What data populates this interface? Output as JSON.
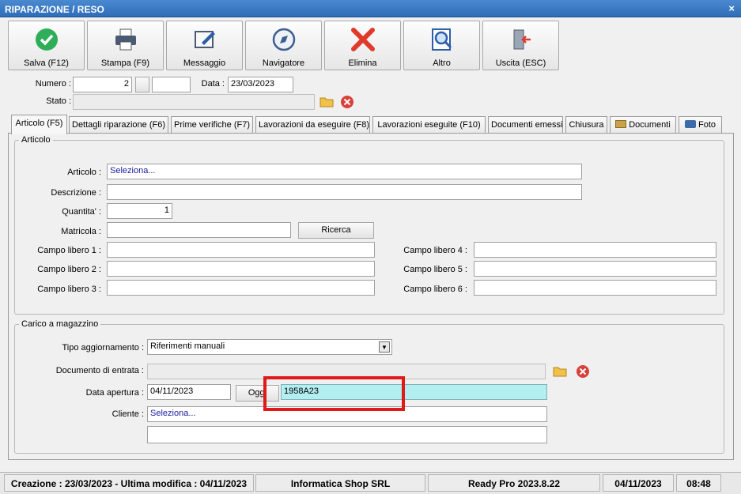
{
  "window": {
    "title": "RIPARAZIONE / RESO",
    "close": "×"
  },
  "toolbar": [
    {
      "label": "Salva (F12)",
      "icon": "check-circle-icon"
    },
    {
      "label": "Stampa (F9)",
      "icon": "printer-icon"
    },
    {
      "label": "Messaggio",
      "icon": "message-edit-icon"
    },
    {
      "label": "Navigatore",
      "icon": "compass-icon"
    },
    {
      "label": "Elimina",
      "icon": "delete-x-icon"
    },
    {
      "label": "Altro",
      "icon": "search-document-icon"
    },
    {
      "label": "Uscita (ESC)",
      "icon": "exit-door-icon"
    }
  ],
  "header": {
    "numero_label": "Numero :",
    "numero_value": "2",
    "data_label": "Data :",
    "data_value": "23/03/2023",
    "stato_label": "Stato :"
  },
  "tabs": [
    "Articolo (F5)",
    "Dettagli riparazione (F6)",
    "Prime verifiche (F7)",
    "Lavorazioni da eseguire (F8)",
    "Lavorazioni eseguite  (F10)",
    "Documenti emessi",
    "Chiusura",
    "Documenti",
    "Foto"
  ],
  "articolo": {
    "group_title": "Articolo",
    "articolo_label": "Articolo :",
    "articolo_value": "Seleziona...",
    "descrizione_label": "Descrizione :",
    "quantita_label": "Quantita' :",
    "quantita_value": "1",
    "matricola_label": "Matricola :",
    "ricerca_label": "Ricerca",
    "campo1_label": "Campo libero 1 :",
    "campo2_label": "Campo libero 2 :",
    "campo3_label": "Campo libero 3 :",
    "campo4_label": "Campo libero 4 :",
    "campo5_label": "Campo libero 5 :",
    "campo6_label": "Campo libero 6 :"
  },
  "carico": {
    "group_title": "Carico a magazzino",
    "tipo_label": "Tipo aggiornamento :",
    "tipo_value": "Riferimenti manuali",
    "documento_label": "Documento di entrata :",
    "data_apertura_label": "Data apertura :",
    "data_apertura_value": "04/11/2023",
    "oggi_label": "Oggi",
    "code_value": "1958A23",
    "cliente_label": "Cliente :",
    "cliente_value": "Seleziona..."
  },
  "status": {
    "creazione": "Creazione : 23/03/2023 - Ultima modifica : 04/11/2023",
    "company": "Informatica Shop SRL",
    "version": "Ready Pro 2023.8.22",
    "date": "04/11/2023",
    "time": "08:48"
  },
  "colors": {
    "titlebar": "#3b7cc6",
    "highlight": "#e01919",
    "active_field": "#b3eef0"
  }
}
